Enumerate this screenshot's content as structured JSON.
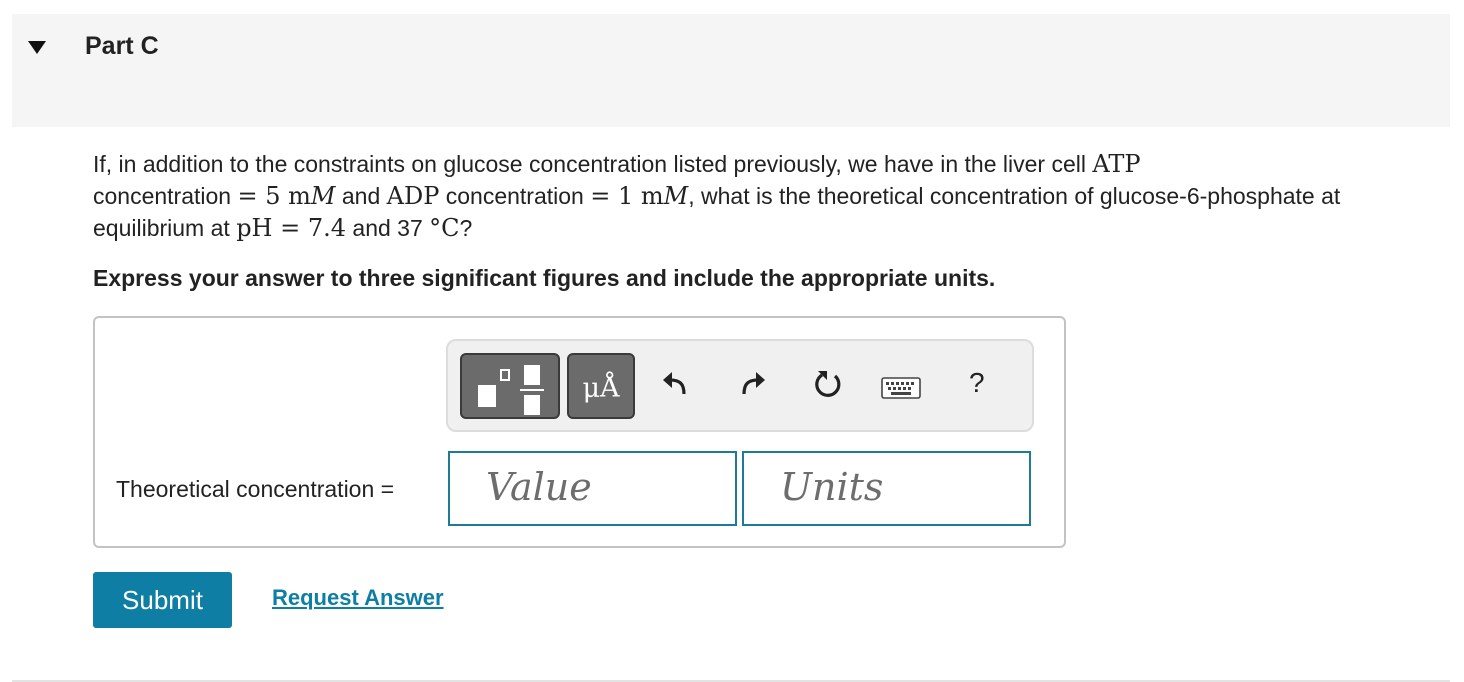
{
  "part": {
    "title": "Part C",
    "expanded": true
  },
  "question": {
    "t1": "If, in addition to the constraints on glucose concentration listed previously, we have in the liver cell ",
    "m_atp": "ATP",
    "t2": " concentration ",
    "m_eq1": "= 5 m",
    "m_M1": "M",
    "t3": " and ",
    "m_adp": "ADP",
    "t4": " concentration ",
    "m_eq2": "= 1 m",
    "m_M2": "M",
    "t5": ", what is the theoretical concentration of glucose-6-phosphate at equilibrium at ",
    "m_ph": "pH = 7.4",
    "t6": " and 37 ",
    "m_deg": "°C",
    "t7": "?"
  },
  "instruction": "Express your answer to three significant figures and include the appropriate units.",
  "toolbar": {
    "units_symbol": "μÅ",
    "help_label": "?",
    "icons": [
      "templates-icon",
      "units-icon",
      "undo-icon",
      "redo-icon",
      "reset-icon",
      "keyboard-icon",
      "help-icon"
    ]
  },
  "answer": {
    "label": "Theoretical concentration =",
    "value_placeholder": "Value",
    "units_placeholder": "Units",
    "value": "",
    "units": ""
  },
  "actions": {
    "submit_label": "Submit",
    "request_label": "Request Answer"
  },
  "colors": {
    "accent": "#0e7ea4",
    "input_border": "#1f7a95",
    "header_bg": "#f5f5f5",
    "toolbar_button": "#6b6b6b"
  }
}
